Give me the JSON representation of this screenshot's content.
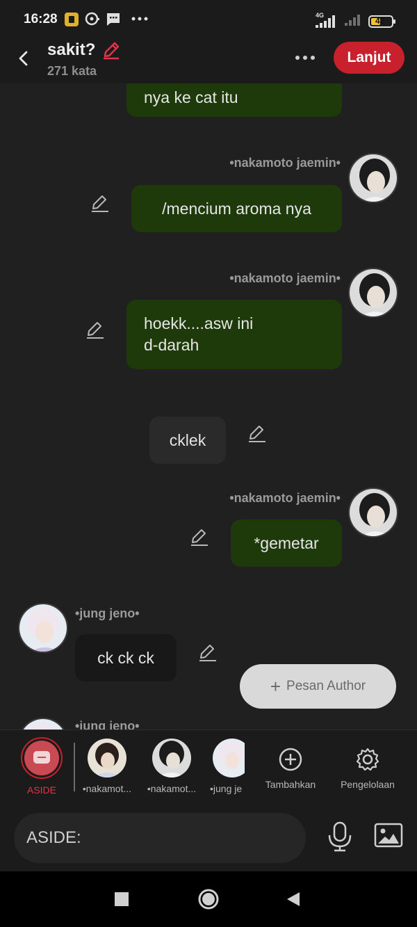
{
  "status_bar": {
    "time": "16:28",
    "network_label": "4G",
    "battery": "42",
    "icons": [
      "app-notification-icon",
      "chat-bubble-icon",
      "message-icon",
      "more-dots-icon",
      "signal-icon",
      "signal-icon-2",
      "battery-icon"
    ]
  },
  "header": {
    "title": "sakit?",
    "word_count": "271 kata",
    "next_label": "Lanjut",
    "accent": "#c8202d"
  },
  "messages": [
    {
      "text": "nya ke cat itu"
    },
    {
      "sender": "•nakamoto jaemin•",
      "text": "/mencium aroma nya"
    },
    {
      "sender": "•nakamoto jaemin•",
      "line1": "hoekk....asw ini",
      "line2": "d-darah"
    },
    {
      "text": "cklek"
    },
    {
      "sender": "•nakamoto jaemin•",
      "text": "*gemetar"
    },
    {
      "sender": "•jung jeno•",
      "text": "ck ck ck"
    },
    {
      "sender": "•jung jeno•"
    }
  ],
  "author_button": {
    "label": "Pesan Author"
  },
  "char_bar": {
    "aside": "ASIDE",
    "char1": "•nakamot...",
    "char2": "•nakamot...",
    "char3": "•jung je",
    "add": "Tambahkan",
    "manage": "Pengelolaan"
  },
  "input": {
    "value": "ASIDE:"
  },
  "colors": {
    "bubble_green": "#1e3a0b",
    "background": "#202020",
    "accent_red": "#c8202d"
  }
}
